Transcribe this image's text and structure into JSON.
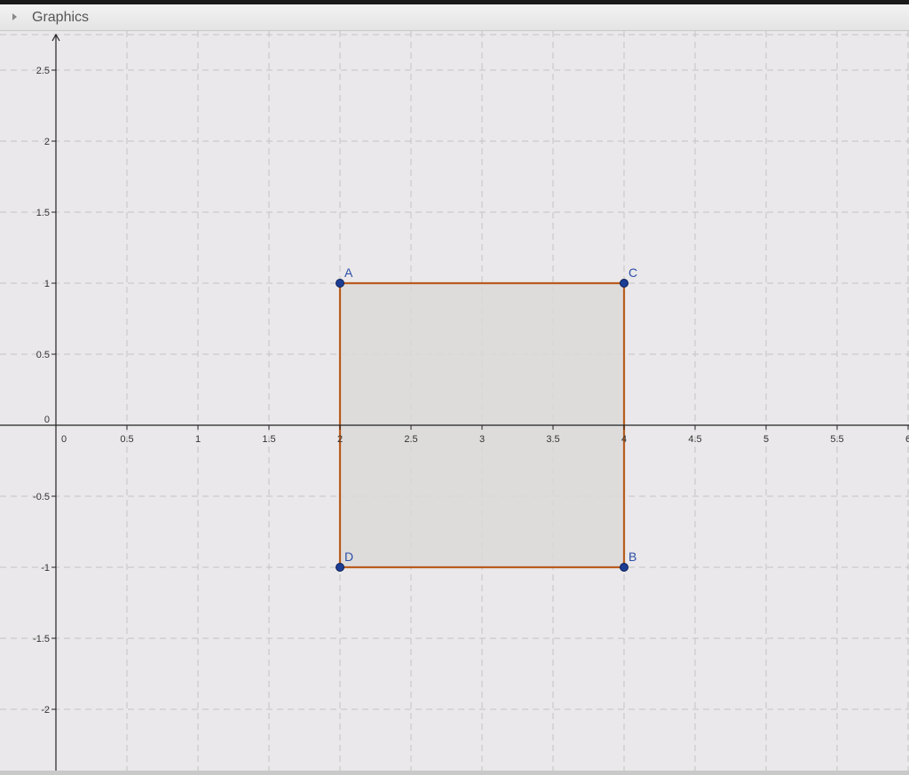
{
  "panel": {
    "title": "Graphics"
  },
  "axes": {
    "x_ticks": [
      "0",
      "0.5",
      "1",
      "1.5",
      "2",
      "2.5",
      "3",
      "3.5",
      "4",
      "4.5",
      "5",
      "5.5",
      "6"
    ],
    "y_ticks": [
      "2.5",
      "2",
      "1.5",
      "1",
      "0.5",
      "0",
      "-0.5",
      "-1",
      "-1.5",
      "-2"
    ],
    "grid": true,
    "xlim": [
      0,
      6
    ],
    "ylim": [
      -2.45,
      2.8
    ]
  },
  "colors": {
    "background": "#eae8ea",
    "grid": "#c4c4c4",
    "axis": "#222222",
    "polygon_stroke": "#b85c1e",
    "polygon_fill": "#dcd8d8",
    "point": "#1c3d94",
    "point_label": "#2b4fa8"
  },
  "points": [
    {
      "label": "A",
      "x": 2,
      "y": 1
    },
    {
      "label": "C",
      "x": 4,
      "y": 1
    },
    {
      "label": "D",
      "x": 2,
      "y": -1
    },
    {
      "label": "B",
      "x": 4,
      "y": -1
    }
  ],
  "polygon": [
    "A",
    "C",
    "B",
    "D"
  ]
}
